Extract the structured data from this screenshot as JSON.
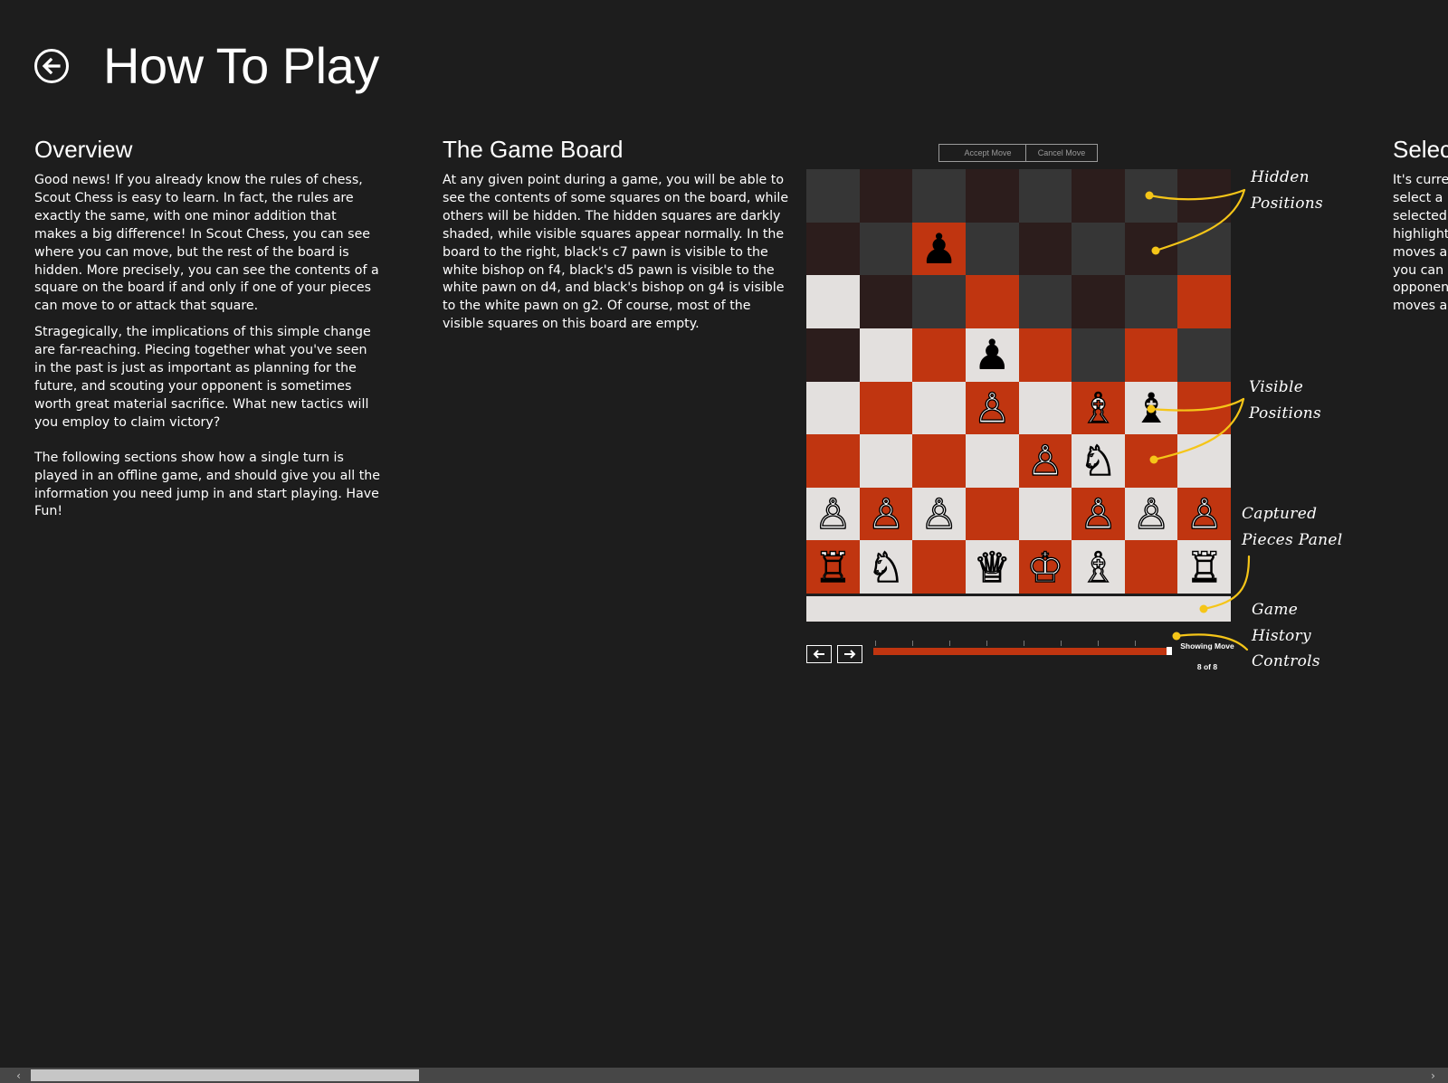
{
  "header": {
    "title": "How To Play"
  },
  "overview": {
    "heading": "Overview",
    "paragraphs": [
      "Good news! If you already know the rules of chess, Scout Chess is easy to learn. In fact, the rules are exactly the same, with one minor addition that makes a big difference! In Scout Chess, you can see where you can move, but the rest of the board is hidden. More precisely, you can see the contents of a square on the board if and only if one of your pieces can move to or attack that square.",
      "Stragegically, the implications of this simple change are far-reaching. Piecing together what you've seen in the past is just as important as planning for the future, and scouting your opponent is sometimes worth great material sacrifice. What new tactics will you employ to claim victory?",
      "The following sections show how a single turn is played in an offline game, and should give you all the information you need jump in and start playing. Have Fun!"
    ]
  },
  "game_board": {
    "heading": "The Game Board",
    "paragraph": "At any given point during a game, you will be able to see the contents of some squares on the board, while others will be hidden. The hidden squares are darkly shaded, while visible squares appear normally. In the board to the right, black's c7 pawn is visible to the white bishop on f4, black's d5 pawn is visible to the white pawn on d4, and black's bishop on g4 is visible to the white pawn on g2. Of course, most of the visible squares on this board are empty.",
    "accept_move": "Accept Move",
    "cancel_move": "Cancel Move",
    "board": {
      "rows": [
        [
          "h",
          "h",
          "h",
          "h",
          "h",
          "h",
          "h",
          "h"
        ],
        [
          "h",
          "h",
          "v",
          "h",
          "h",
          "h",
          "h",
          "h"
        ],
        [
          "v",
          "h",
          "h",
          "v",
          "h",
          "h",
          "h",
          "v"
        ],
        [
          "h",
          "v",
          "v",
          "v",
          "v",
          "h",
          "v",
          "h"
        ],
        [
          "v",
          "v",
          "v",
          "v",
          "v",
          "v",
          "v",
          "v"
        ],
        [
          "v",
          "v",
          "v",
          "v",
          "v",
          "v",
          "v",
          "v"
        ],
        [
          "v",
          "v",
          "v",
          "v",
          "v",
          "v",
          "v",
          "v"
        ],
        [
          "v",
          "v",
          "v",
          "v",
          "v",
          "v",
          "v",
          "v"
        ]
      ],
      "pieces": [
        {
          "row": 1,
          "col": 2,
          "glyph": "♟",
          "color": "black"
        },
        {
          "row": 3,
          "col": 3,
          "glyph": "♟",
          "color": "black"
        },
        {
          "row": 4,
          "col": 3,
          "glyph": "♙",
          "color": "white"
        },
        {
          "row": 4,
          "col": 5,
          "glyph": "♗",
          "color": "white"
        },
        {
          "row": 4,
          "col": 6,
          "glyph": "♝",
          "color": "black"
        },
        {
          "row": 5,
          "col": 4,
          "glyph": "♙",
          "color": "white"
        },
        {
          "row": 5,
          "col": 5,
          "glyph": "♘",
          "color": "white"
        },
        {
          "row": 6,
          "col": 0,
          "glyph": "♙",
          "color": "white"
        },
        {
          "row": 6,
          "col": 1,
          "glyph": "♙",
          "color": "white"
        },
        {
          "row": 6,
          "col": 2,
          "glyph": "♙",
          "color": "white"
        },
        {
          "row": 6,
          "col": 5,
          "glyph": "♙",
          "color": "white"
        },
        {
          "row": 6,
          "col": 6,
          "glyph": "♙",
          "color": "white"
        },
        {
          "row": 6,
          "col": 7,
          "glyph": "♙",
          "color": "white"
        },
        {
          "row": 7,
          "col": 0,
          "glyph": "♖",
          "color": "white"
        },
        {
          "row": 7,
          "col": 1,
          "glyph": "♘",
          "color": "white"
        },
        {
          "row": 7,
          "col": 3,
          "glyph": "♕",
          "color": "white"
        },
        {
          "row": 7,
          "col": 4,
          "glyph": "♔",
          "color": "white"
        },
        {
          "row": 7,
          "col": 5,
          "glyph": "♗",
          "color": "white"
        },
        {
          "row": 7,
          "col": 7,
          "glyph": "♖",
          "color": "white"
        }
      ]
    },
    "history": {
      "label": "Showing Move",
      "count": "8 of 8",
      "position": 1.0,
      "prev_icon": "arrow-left-icon",
      "next_icon": "arrow-right-icon"
    },
    "annotations": {
      "hidden": [
        "Hidden",
        "Positions"
      ],
      "visible": [
        "Visible",
        "Positions"
      ],
      "captured": [
        "Captured",
        "Pieces Panel"
      ],
      "history": [
        "Game",
        "History",
        "Controls"
      ]
    }
  },
  "next_section": {
    "heading": "Select",
    "lines": [
      "It's curren",
      "select a pi",
      "selected, t",
      "highlighte",
      "moves are",
      "you can c",
      "opponent",
      "moves are"
    ]
  },
  "colors": {
    "background": "#1d1d1d",
    "hidden_dark": "#2c1d1c",
    "hidden_light": "#363636",
    "visible_dark": "#c03510",
    "visible_light": "#e3e0de",
    "callout": "#f5c518"
  }
}
